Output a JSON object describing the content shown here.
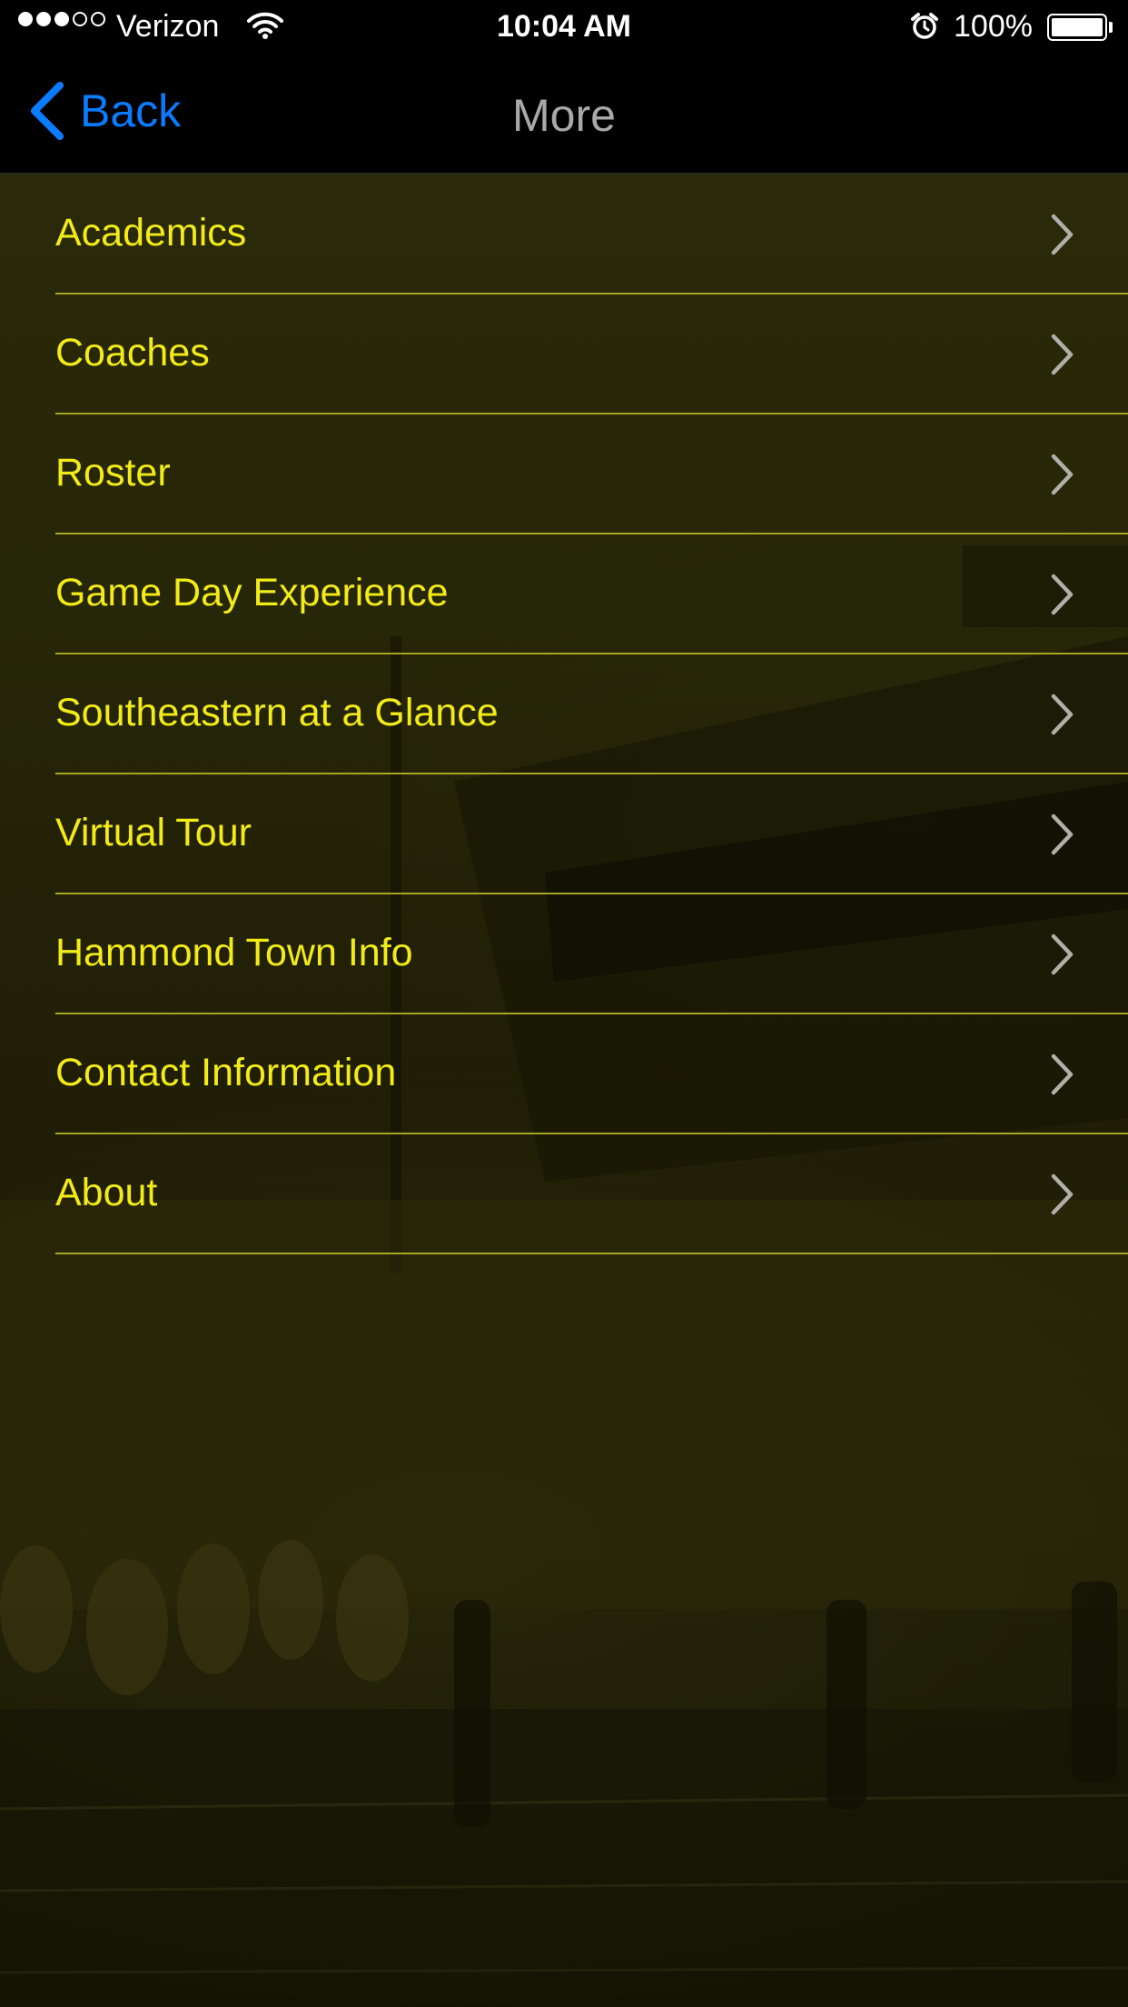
{
  "status_bar": {
    "signal_bars_filled": 3,
    "signal_bars_total": 5,
    "carrier": "Verizon",
    "wifi_icon": "wifi-icon",
    "time": "10:04 AM",
    "alarm_icon": "alarm-clock-icon",
    "battery_percent": "100%",
    "battery_level": 1.0
  },
  "nav_bar": {
    "back_label": "Back",
    "back_icon": "chevron-left-icon",
    "title": "More"
  },
  "menu": {
    "chevron_icon": "chevron-right-icon",
    "items": [
      {
        "label": "Academics"
      },
      {
        "label": "Coaches"
      },
      {
        "label": "Roster"
      },
      {
        "label": "Game Day Experience"
      },
      {
        "label": "Southeastern at a Glance"
      },
      {
        "label": "Virtual Tour"
      },
      {
        "label": "Hammond Town Info"
      },
      {
        "label": "Contact Information"
      },
      {
        "label": "About"
      }
    ]
  },
  "colors": {
    "accent_blue": "#0a7cff",
    "menu_text_yellow": "#f2eb18",
    "separator_yellow": "#a9a524",
    "title_gray": "#a9a9a9",
    "background_olive": "#262608"
  }
}
